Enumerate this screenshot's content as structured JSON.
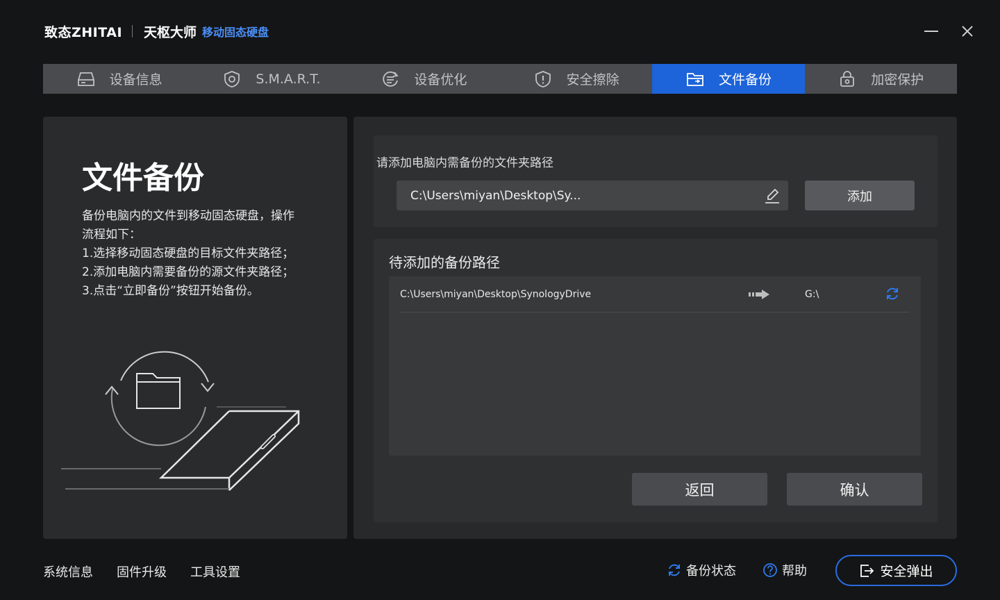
{
  "titlebar": {
    "logo": "致态ZHITAI",
    "app_name": "天枢大师",
    "subtitle": "移动固态硬盘"
  },
  "tabs": [
    {
      "label": "设备信息",
      "icon": "drive-icon",
      "active": false
    },
    {
      "label": "S.M.A.R.T.",
      "icon": "shield-icon",
      "active": false
    },
    {
      "label": "设备优化",
      "icon": "optimize-icon",
      "active": false
    },
    {
      "label": "安全擦除",
      "icon": "shield-alert-icon",
      "active": false
    },
    {
      "label": "文件备份",
      "icon": "folder-icon",
      "active": true
    },
    {
      "label": "加密保护",
      "icon": "lock-icon",
      "active": false
    }
  ],
  "left_panel": {
    "title": "文件备份",
    "desc_lines": [
      "备份电脑内的文件到移动固态硬盘，操作",
      "流程如下：",
      "1.选择移动固态硬盘的目标文件夹路径；",
      "2.添加电脑内需要备份的源文件夹路径；",
      "3.点击“立即备份”按钮开始备份。"
    ]
  },
  "add_section": {
    "label": "请添加电脑内需备份的文件夹路径",
    "path_value": "C:\\Users\\miyan\\Desktop\\Sy...",
    "add_button": "添加"
  },
  "pending_section": {
    "title": "待添加的备份路径",
    "rows": [
      {
        "source": "C:\\Users\\miyan\\Desktop\\SynologyDrive",
        "destination": "G:\\"
      }
    ],
    "back_button": "返回",
    "confirm_button": "确认"
  },
  "footer": {
    "system_info": "系统信息",
    "firmware_upgrade": "固件升级",
    "tool_settings": "工具设置",
    "backup_status": "备份状态",
    "help": "帮助",
    "safe_eject": "安全弹出"
  },
  "colors": {
    "accent": "#1d63d9",
    "accent_light": "#4a8ef5",
    "background": "#141516",
    "panel": "#2a2b2d"
  }
}
